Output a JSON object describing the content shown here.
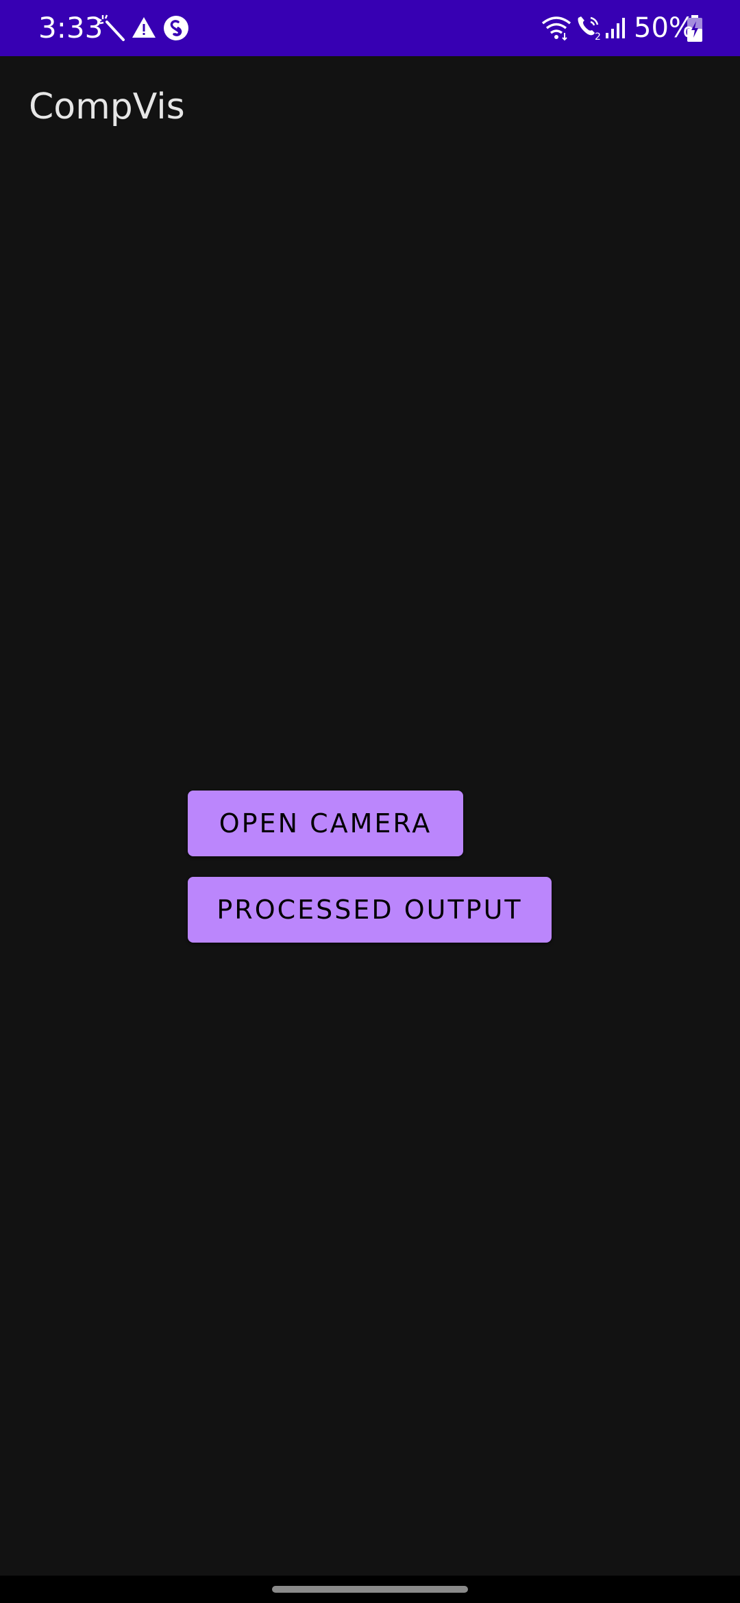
{
  "status_bar": {
    "time": "3:33",
    "battery": "50%",
    "background_color": "#3700b3",
    "icons": [
      "magic-wand-icon",
      "warning-icon",
      "shazam-icon",
      "wifi-icon",
      "wifi-calling-icon",
      "signal-icon",
      "battery-charging-icon"
    ],
    "wifi_calling_sim": "2"
  },
  "app_bar": {
    "title": "CompVis"
  },
  "main": {
    "open_camera_label": "OPEN CAMERA",
    "processed_output_label": "PROCESSED OUTPUT",
    "button_color": "#bb86fc"
  },
  "theme": {
    "background": "#121212"
  }
}
